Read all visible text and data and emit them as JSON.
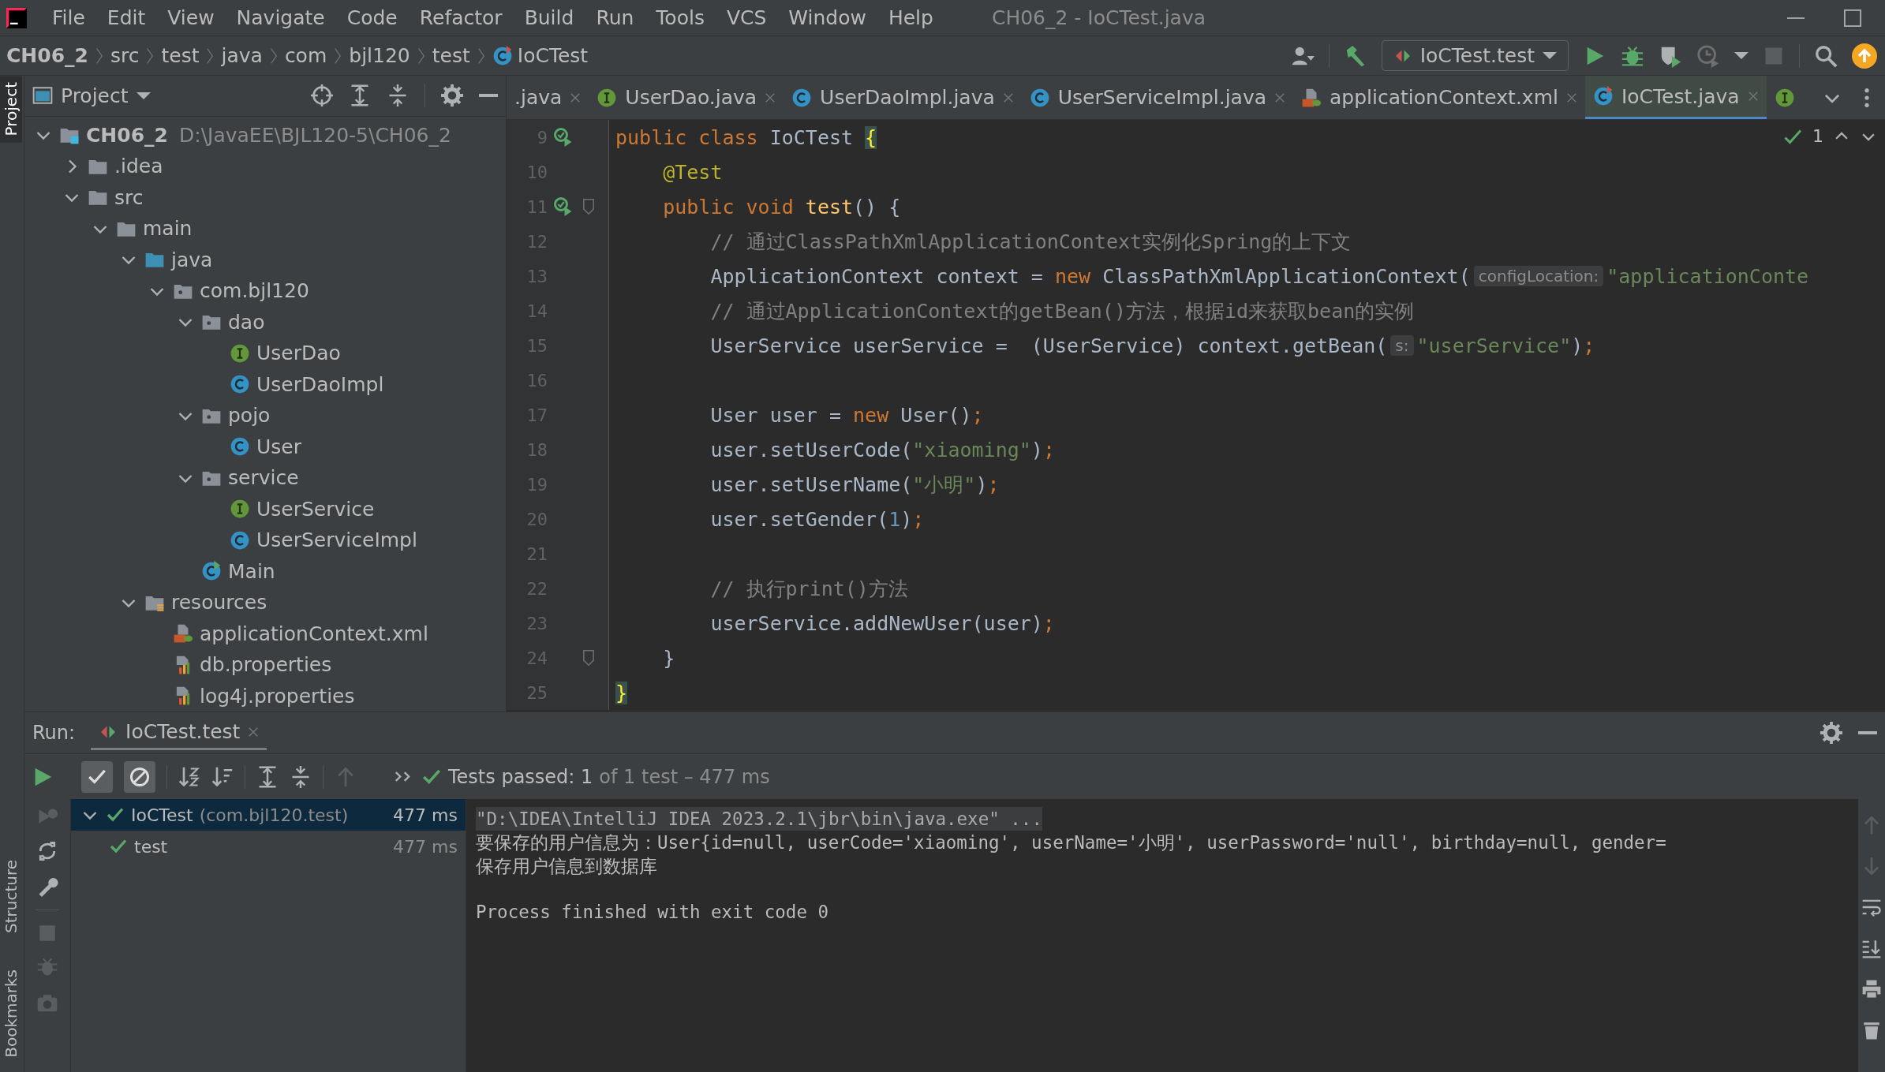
{
  "menu": [
    "File",
    "Edit",
    "View",
    "Navigate",
    "Code",
    "Refactor",
    "Build",
    "Run",
    "Tools",
    "VCS",
    "Window",
    "Help"
  ],
  "window_title": "CH06_2 - IoCTest.java",
  "breadcrumb": [
    {
      "label": "CH06_2",
      "kind": "project"
    },
    {
      "label": "src",
      "kind": "dir"
    },
    {
      "label": "test",
      "kind": "dir"
    },
    {
      "label": "java",
      "kind": "dir"
    },
    {
      "label": "com",
      "kind": "dir"
    },
    {
      "label": "bjl120",
      "kind": "dir"
    },
    {
      "label": "test",
      "kind": "dir"
    },
    {
      "label": "IoCTest",
      "kind": "class"
    }
  ],
  "run_config": "IoCTest.test",
  "side_tabs": {
    "top": [
      {
        "label": "Project",
        "selected": true
      }
    ],
    "bottom": [
      {
        "label": "Structure",
        "selected": false
      },
      {
        "label": "Bookmarks",
        "selected": false
      }
    ]
  },
  "project_panel": {
    "title": "Project",
    "tree": [
      {
        "label": "CH06_2",
        "path": "D:\\JavaEE\\BJL120-5\\CH06_2",
        "kind": "project",
        "expanded": true,
        "children": [
          {
            "label": ".idea",
            "kind": "folder",
            "expanded": false
          },
          {
            "label": "src",
            "kind": "folder",
            "expanded": true,
            "children": [
              {
                "label": "main",
                "kind": "folder",
                "expanded": true,
                "children": [
                  {
                    "label": "java",
                    "kind": "source",
                    "expanded": true,
                    "children": [
                      {
                        "label": "com.bjl120",
                        "kind": "package",
                        "expanded": true,
                        "children": [
                          {
                            "label": "dao",
                            "kind": "package",
                            "expanded": true,
                            "children": [
                              {
                                "label": "UserDao",
                                "kind": "interface"
                              },
                              {
                                "label": "UserDaoImpl",
                                "kind": "class"
                              }
                            ]
                          },
                          {
                            "label": "pojo",
                            "kind": "package",
                            "expanded": true,
                            "children": [
                              {
                                "label": "User",
                                "kind": "class"
                              }
                            ]
                          },
                          {
                            "label": "service",
                            "kind": "package",
                            "expanded": true,
                            "children": [
                              {
                                "label": "UserService",
                                "kind": "interface"
                              },
                              {
                                "label": "UserServiceImpl",
                                "kind": "class"
                              }
                            ]
                          },
                          {
                            "label": "Main",
                            "kind": "main"
                          }
                        ]
                      }
                    ]
                  },
                  {
                    "label": "resources",
                    "kind": "resources",
                    "expanded": true,
                    "children": [
                      {
                        "label": "applicationContext.xml",
                        "kind": "xml"
                      },
                      {
                        "label": "db.properties",
                        "kind": "properties"
                      },
                      {
                        "label": "log4j.properties",
                        "kind": "properties"
                      }
                    ]
                  }
                ]
              }
            ]
          }
        ]
      }
    ]
  },
  "editor_tabs": [
    {
      "label": ".java",
      "kind": "file",
      "selected": false
    },
    {
      "label": "UserDao.java",
      "kind": "interface",
      "selected": false
    },
    {
      "label": "UserDaoImpl.java",
      "kind": "class",
      "selected": false
    },
    {
      "label": "UserServiceImpl.java",
      "kind": "class",
      "selected": false
    },
    {
      "label": "applicationContext.xml",
      "kind": "xml",
      "selected": false
    },
    {
      "label": "IoCTest.java",
      "kind": "test",
      "selected": true
    },
    {
      "kind": "interface",
      "selected": false
    }
  ],
  "editor": {
    "inspection_count": "1",
    "lines": [
      {
        "number": "9",
        "run_marker": true,
        "fold": false,
        "segments": [
          {
            "text": "public class ",
            "kind": "kw"
          },
          {
            "text": "IoCTest ",
            "kind": "plain"
          },
          {
            "text": "{",
            "kind": "brace"
          }
        ]
      },
      {
        "number": "10",
        "run_marker": false,
        "fold": false,
        "segments": [
          {
            "text": "    @Test",
            "kind": "ann"
          }
        ]
      },
      {
        "number": "11",
        "run_marker": true,
        "fold": true,
        "segments": [
          {
            "text": "    public void ",
            "kind": "kw"
          },
          {
            "text": "test",
            "kind": "method"
          },
          {
            "text": "() {",
            "kind": "plain"
          }
        ]
      },
      {
        "number": "12",
        "run_marker": false,
        "fold": false,
        "segments": [
          {
            "text": "        // 通过ClassPathXmlApplicationContext实例化Spring的上下文",
            "kind": "comment"
          }
        ]
      },
      {
        "number": "13",
        "run_marker": false,
        "fold": false,
        "segments": [
          {
            "text": "        ApplicationContext context = ",
            "kind": "plain"
          },
          {
            "text": "new ",
            "kind": "kw"
          },
          {
            "text": "ClassPathXmlApplicationContext(",
            "kind": "plain"
          },
          {
            "text": "configLocation:",
            "kind": "hint"
          },
          {
            "text": "\"applicationConte",
            "kind": "string"
          }
        ]
      },
      {
        "number": "14",
        "run_marker": false,
        "fold": false,
        "segments": [
          {
            "text": "        // 通过ApplicationContext的getBean()方法，根据id来获取bean的实例",
            "kind": "comment"
          }
        ]
      },
      {
        "number": "15",
        "run_marker": false,
        "fold": false,
        "segments": [
          {
            "text": "        UserService userService =  (UserService) context.getBean(",
            "kind": "plain"
          },
          {
            "text": "s:",
            "kind": "hint"
          },
          {
            "text": "\"userService\"",
            "kind": "string"
          },
          {
            "text": ")",
            "kind": "plain"
          },
          {
            "text": ";",
            "kind": "kw"
          }
        ]
      },
      {
        "number": "16",
        "run_marker": false,
        "fold": false
      },
      {
        "number": "17",
        "run_marker": false,
        "fold": false,
        "segments": [
          {
            "text": "        User user = ",
            "kind": "plain"
          },
          {
            "text": "new ",
            "kind": "kw"
          },
          {
            "text": "User()",
            "kind": "plain"
          },
          {
            "text": ";",
            "kind": "kw"
          }
        ]
      },
      {
        "number": "18",
        "run_marker": false,
        "fold": false,
        "segments": [
          {
            "text": "        user.setUserCode(",
            "kind": "plain"
          },
          {
            "text": "\"xiaoming\"",
            "kind": "string"
          },
          {
            "text": ")",
            "kind": "plain"
          },
          {
            "text": ";",
            "kind": "kw"
          }
        ]
      },
      {
        "number": "19",
        "run_marker": false,
        "fold": false,
        "segments": [
          {
            "text": "        user.setUserName(",
            "kind": "plain"
          },
          {
            "text": "\"小明\"",
            "kind": "string"
          },
          {
            "text": ")",
            "kind": "plain"
          },
          {
            "text": ";",
            "kind": "kw"
          }
        ]
      },
      {
        "number": "20",
        "run_marker": false,
        "fold": false,
        "segments": [
          {
            "text": "        user.setGender(",
            "kind": "plain"
          },
          {
            "text": "1",
            "kind": "number"
          },
          {
            "text": ")",
            "kind": "plain"
          },
          {
            "text": ";",
            "kind": "kw"
          }
        ]
      },
      {
        "number": "21",
        "run_marker": false,
        "fold": false
      },
      {
        "number": "22",
        "run_marker": false,
        "fold": false,
        "segments": [
          {
            "text": "        // 执行print()方法",
            "kind": "comment"
          }
        ]
      },
      {
        "number": "23",
        "run_marker": false,
        "fold": false,
        "segments": [
          {
            "text": "        userService.addNewUser(user)",
            "kind": "plain"
          },
          {
            "text": ";",
            "kind": "kw"
          }
        ]
      },
      {
        "number": "24",
        "run_marker": false,
        "fold": true,
        "segments": [
          {
            "text": "    }",
            "kind": "plain"
          }
        ]
      },
      {
        "number": "25",
        "run_marker": false,
        "fold": false,
        "segments": [
          {
            "text": "}",
            "kind": "brace"
          }
        ]
      }
    ]
  },
  "run_panel": {
    "label": "Run:",
    "tab": "IoCTest.test",
    "filters": [
      {
        "kind": "passed",
        "on": true
      },
      {
        "kind": "ignored",
        "on": true
      }
    ],
    "status": {
      "passed": "Tests passed: 1",
      "detail": "of 1 test – 477 ms"
    },
    "tests": [
      {
        "name": "IoCTest",
        "package": "(com.bjl120.test)",
        "time": "477 ms",
        "selected": true,
        "expanded": true,
        "children": [
          {
            "name": "test",
            "time": "477 ms",
            "selected": false
          }
        ]
      }
    ],
    "console": [
      {
        "text": "\"D:\\IDEA\\IntelliJ IDEA 2023.2.1\\jbr\\bin\\java.exe\" ...",
        "kind": "command"
      },
      {
        "text": "要保存的用户信息为：User{id=null, userCode='xiaoming', userName='小明', userPassword='null', birthday=null, gender=",
        "kind": "output"
      },
      {
        "text": "保存用户信息到数据库",
        "kind": "output"
      },
      {
        "text": "Process finished with exit code 0",
        "kind": "exit"
      }
    ]
  }
}
